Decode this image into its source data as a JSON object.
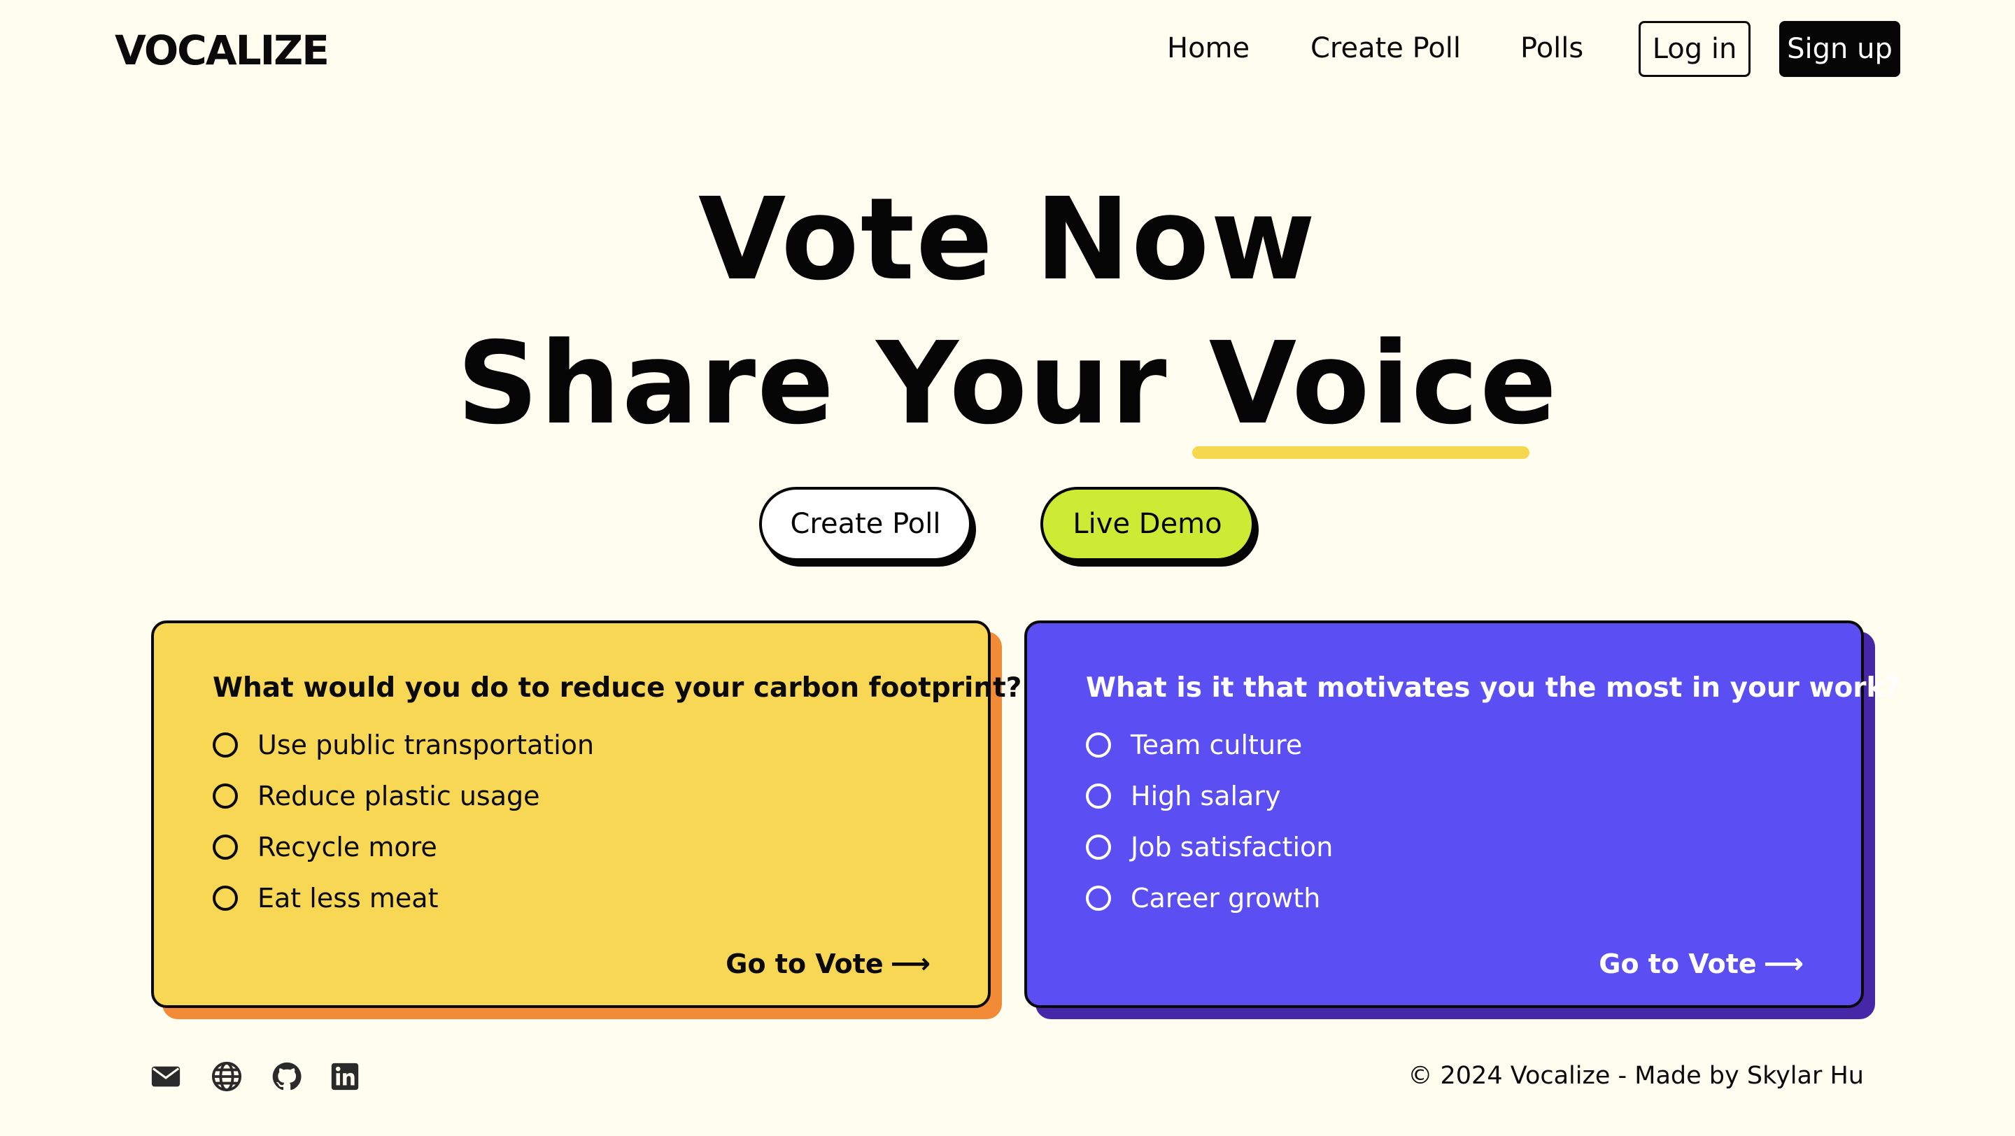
{
  "header": {
    "logo": "VOCALIZE",
    "nav": {
      "home": "Home",
      "create_poll": "Create Poll",
      "polls": "Polls"
    },
    "login_label": "Log in",
    "signup_label": "Sign up"
  },
  "hero": {
    "line1": "Vote Now",
    "line2_prefix": "Share Your ",
    "line2_highlight": "Voice",
    "create_poll_label": "Create Poll",
    "live_demo_label": "Live Demo"
  },
  "polls": [
    {
      "question": "What would you do to reduce your carbon footprint?",
      "options": [
        "Use public transportation",
        "Reduce plastic usage",
        "Recycle more",
        "Eat less meat"
      ],
      "cta": "Go to Vote"
    },
    {
      "question": "What is it that motivates you the most in your work?",
      "options": [
        "Team culture",
        "High salary",
        "Job satisfaction",
        "Career growth"
      ],
      "cta": "Go to Vote"
    }
  ],
  "footer": {
    "icons": [
      "mail-icon",
      "globe-icon",
      "github-icon",
      "linkedin-icon"
    ],
    "copyright": "© 2024 Vocalize - Made by Skylar Hu"
  },
  "colors": {
    "background": "#fefdf0",
    "yellow_card": "#f8d755",
    "yellow_shadow": "#f28b35",
    "purple_card": "#5b4ef3",
    "purple_shadow": "#4627a8",
    "live_demo": "#cdeb34",
    "highlight_underline": "#f6d84f"
  }
}
